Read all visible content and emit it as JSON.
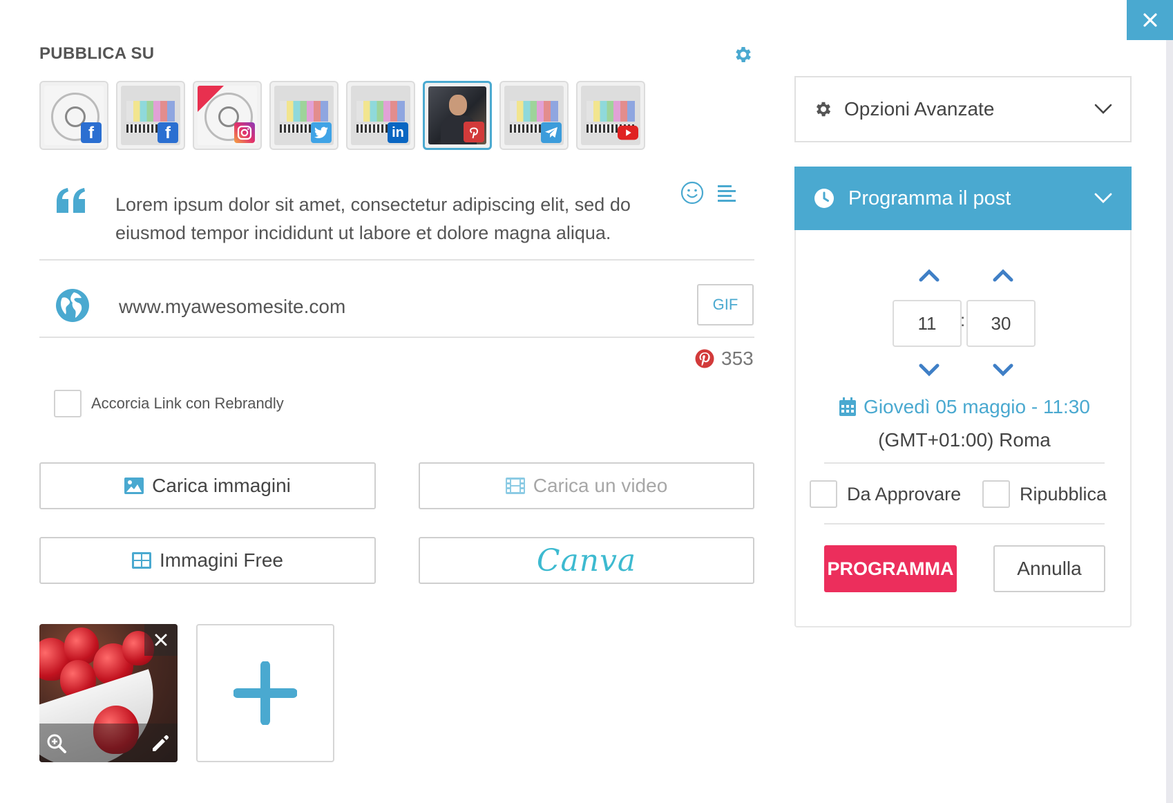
{
  "header": {
    "title": "PUBBLICA SU"
  },
  "accounts": [
    {
      "id": "acc-1",
      "network": "facebook",
      "style": "seal",
      "badge_icon": "facebook-icon",
      "selected": false
    },
    {
      "id": "acc-2",
      "network": "facebook",
      "style": "testcard",
      "badge_icon": "facebook-icon",
      "selected": false
    },
    {
      "id": "acc-3",
      "network": "instagram",
      "style": "seal",
      "badge_icon": "instagram-icon",
      "selected": false
    },
    {
      "id": "acc-4",
      "network": "twitter",
      "style": "testcard",
      "badge_icon": "twitter-icon",
      "selected": false
    },
    {
      "id": "acc-5",
      "network": "linkedin",
      "style": "testcard",
      "badge_icon": "linkedin-icon",
      "selected": false
    },
    {
      "id": "acc-6",
      "network": "pinterest",
      "style": "person",
      "badge_icon": "pinterest-icon",
      "selected": true
    },
    {
      "id": "acc-7",
      "network": "telegram",
      "style": "testcard",
      "badge_icon": "telegram-icon",
      "selected": false
    },
    {
      "id": "acc-8",
      "network": "youtube",
      "style": "testcard",
      "badge_icon": "youtube-icon",
      "selected": false
    }
  ],
  "editor": {
    "text": "Lorem ipsum dolor sit amet, consectetur adipiscing elit, sed do eiusmod tempor incididunt ut labore et dolore magna aliqua.",
    "url": "www.myawesomesite.com",
    "gif_label": "GIF",
    "char_count": "353"
  },
  "shorten": {
    "label": "Accorcia Link con Rebrandly",
    "checked": false
  },
  "buttons": {
    "upload_images": "Carica immagini",
    "upload_video": "Carica un video",
    "free_images": "Immagini Free",
    "canva": "Canva"
  },
  "advanced": {
    "label": "Opzioni Avanzate"
  },
  "schedule": {
    "title": "Programma il post",
    "hour": "11",
    "minute": "30",
    "separator": ":",
    "date_text": "Giovedì 05 maggio - 11:30",
    "timezone": "(GMT+01:00) Roma",
    "approve_label": "Da Approvare",
    "republish_label": "Ripubblica",
    "submit_label": "PROGRAMMA",
    "cancel_label": "Annulla"
  },
  "colors": {
    "accent": "#4aa9d0",
    "primary_action": "#ec2e5c",
    "pinterest": "#d23a3a"
  }
}
